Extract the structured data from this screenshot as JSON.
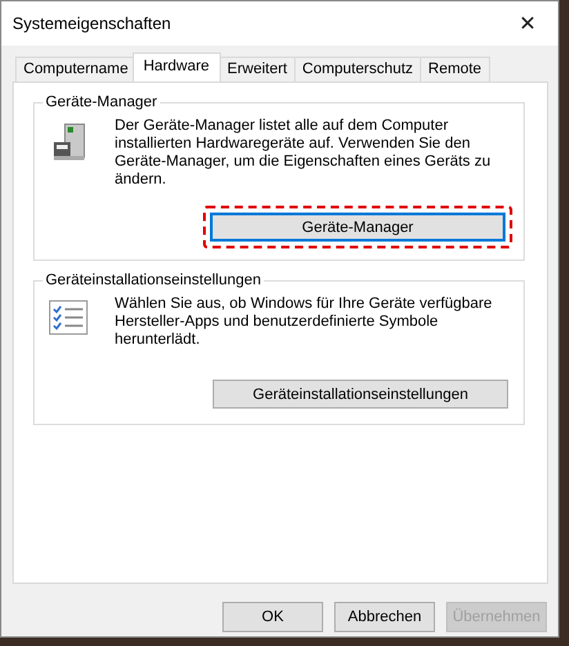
{
  "window": {
    "title": "Systemeigenschaften",
    "close": "✕"
  },
  "tabs": [
    {
      "label": "Computername",
      "selected": false
    },
    {
      "label": "Hardware",
      "selected": true
    },
    {
      "label": "Erweitert",
      "selected": false
    },
    {
      "label": "Computerschutz",
      "selected": false
    },
    {
      "label": "Remote",
      "selected": false
    }
  ],
  "groups": [
    {
      "title": "Geräte-Manager",
      "kind": "device-manager",
      "text": "Der Geräte-Manager listet alle auf dem Computer installierten Hardwaregeräte auf. Verwenden Sie den Geräte-Manager, um die Eigenschaften eines Geräts zu ändern.",
      "button": {
        "label": "Geräte-Manager",
        "focused": true,
        "highlighted": true
      }
    },
    {
      "title": "Geräteinstallationseinstellungen",
      "kind": "checklist",
      "text": "Wählen Sie aus, ob Windows für Ihre Geräte verfügbare Hersteller-Apps und benutzerdefinierte Symbole herunterlädt.",
      "button": {
        "label": "Geräteinstallationseinstellungen",
        "focused": false,
        "highlighted": false
      }
    }
  ],
  "buttons": [
    {
      "label": "OK",
      "disabled": false
    },
    {
      "label": "Abbrechen",
      "disabled": false
    },
    {
      "label": "Übernehmen",
      "disabled": true
    }
  ]
}
